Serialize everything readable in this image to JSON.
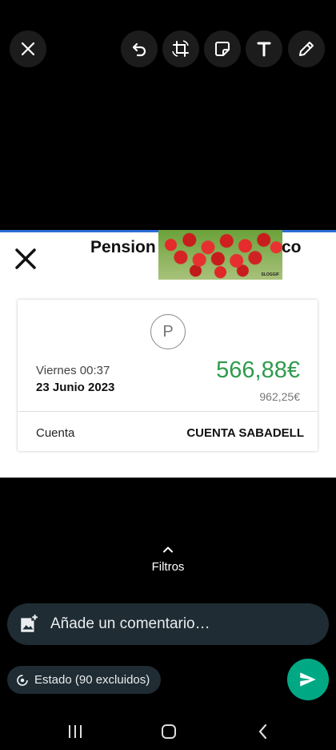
{
  "toolbar": {
    "close_icon": "close-icon",
    "undo_icon": "undo-icon",
    "crop_rotate_icon": "crop-rotate-icon",
    "sticker_icon": "sticker-icon",
    "text_icon": "text-icon",
    "draw_icon": "pencil-icon"
  },
  "screenshot": {
    "title_left": "Pension",
    "title_right": "co",
    "gif_watermark": "SLOGGIF",
    "transaction": {
      "avatar_letter": "P",
      "day_time": "Viernes 00:37",
      "date": "23 Junio 2023",
      "amount": "566,88€",
      "balance": "962,25€",
      "account_label": "Cuenta",
      "account_value": "CUENTA SABADELL"
    },
    "amount_color": "#2e9b4c"
  },
  "filters": {
    "label": "Filtros"
  },
  "comment": {
    "placeholder": "Añade un comentario…"
  },
  "status": {
    "label": "Estado (90 excluidos)"
  },
  "colors": {
    "send_button": "#00a884",
    "input_bg": "#1f2c34"
  }
}
